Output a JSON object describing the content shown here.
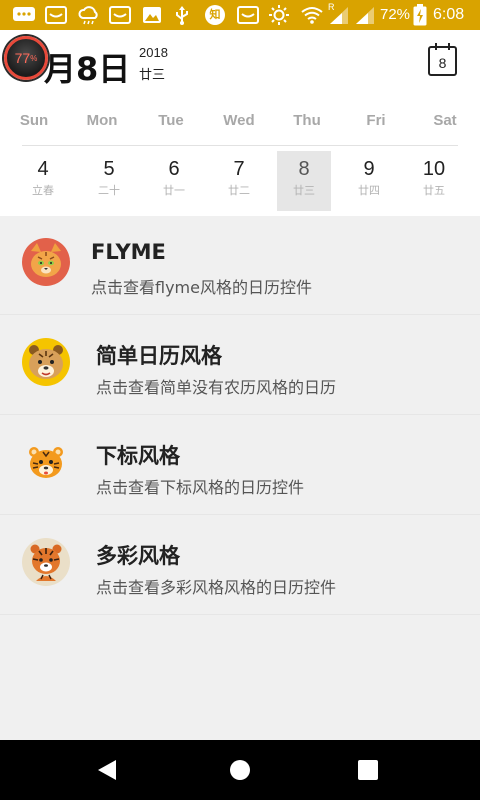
{
  "status_bar": {
    "background": "#d9a300",
    "icons": [
      "messaging-icon",
      "mail-icon",
      "cloud-icon",
      "mail-icon",
      "image-icon",
      "usb-icon",
      "zhihu-icon",
      "mail-icon",
      "brightness-icon",
      "wifi-icon",
      "signal-icon",
      "signal-icon"
    ],
    "zhihu_label": "知",
    "roaming_label": "R",
    "battery": "72%",
    "time": "6:08"
  },
  "header": {
    "badge": {
      "value": "77",
      "unit": "%"
    },
    "title": "月8日",
    "year": "2018",
    "lunar": "廿三",
    "today_button_day": "8"
  },
  "calendar": {
    "weekdays": [
      "Sun",
      "Mon",
      "Tue",
      "Wed",
      "Thu",
      "Fri",
      "Sat"
    ],
    "days": [
      {
        "day": "4",
        "lunar": "立春"
      },
      {
        "day": "5",
        "lunar": "二十"
      },
      {
        "day": "6",
        "lunar": "廿一"
      },
      {
        "day": "7",
        "lunar": "廿二"
      },
      {
        "day": "8",
        "lunar": "廿三",
        "selected": true
      },
      {
        "day": "9",
        "lunar": "廿四"
      },
      {
        "day": "10",
        "lunar": "廿五"
      }
    ]
  },
  "styles": [
    {
      "title": "FLYME",
      "subtitle": "点击查看flyme风格的日历控件",
      "avatar": "tiger-cat-icon"
    },
    {
      "title": "简单日历风格",
      "subtitle": "点击查看简单没有农历风格的日历",
      "avatar": "tiger-face-icon"
    },
    {
      "title": "下标风格",
      "subtitle": "点击查看下标风格的日历控件",
      "avatar": "tiger-cub-icon"
    },
    {
      "title": "多彩风格",
      "subtitle": "点击查看多彩风格风格的日历控件",
      "avatar": "tiger-portrait-icon"
    }
  ],
  "nav_bar": {
    "buttons": [
      "back-icon",
      "home-icon",
      "recents-icon"
    ]
  }
}
